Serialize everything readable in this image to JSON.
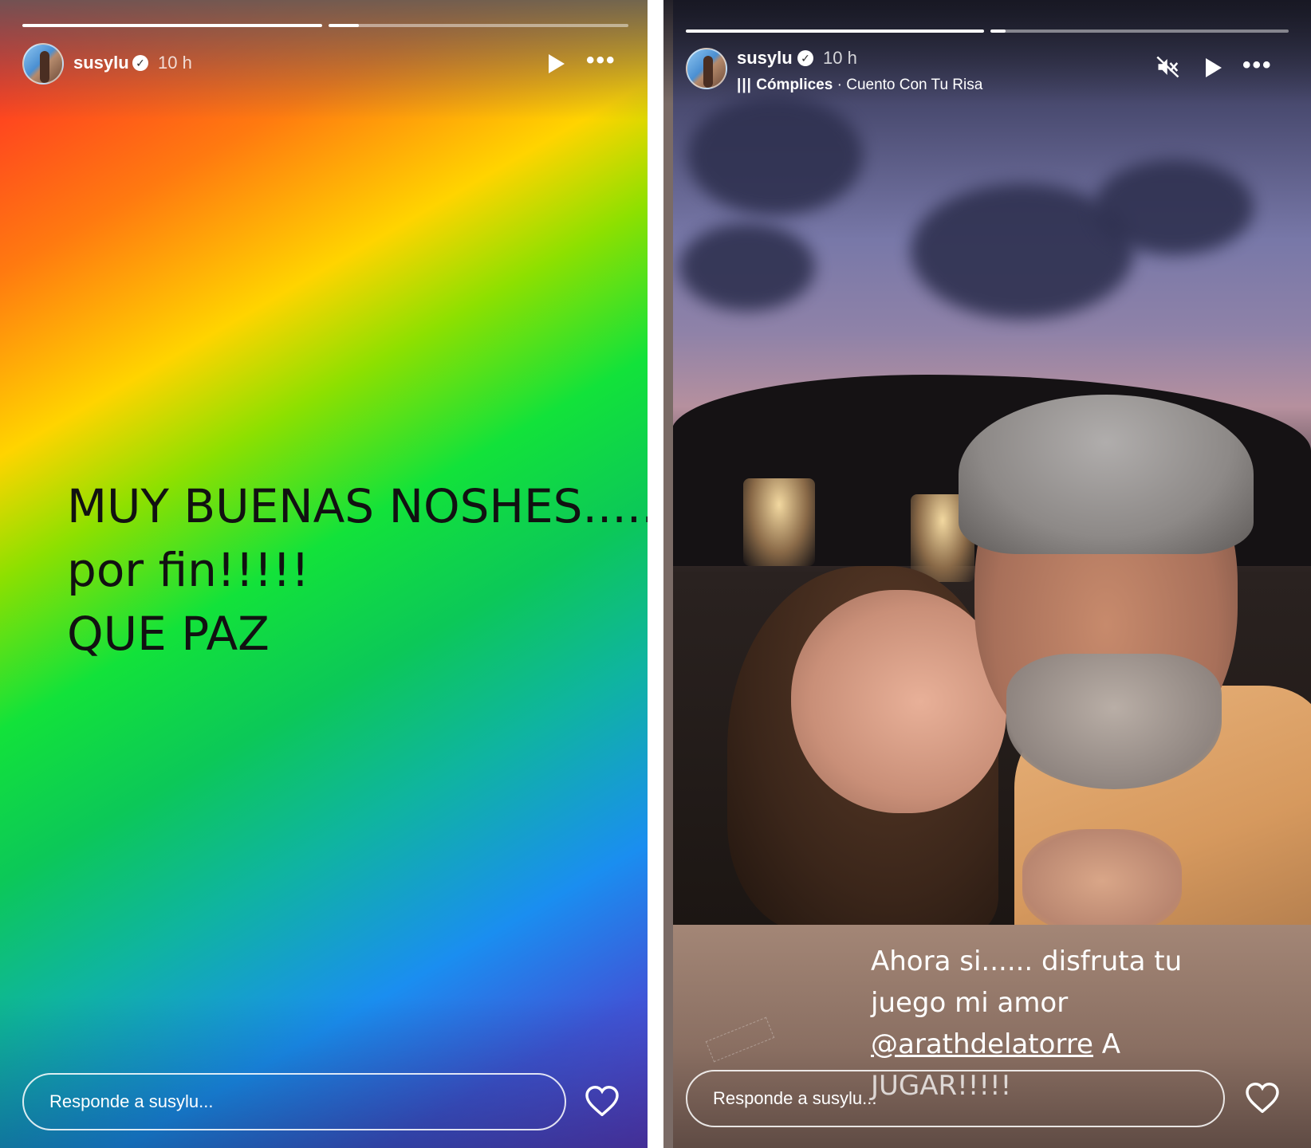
{
  "left_story": {
    "username": "susylu",
    "time": "10 h",
    "progress": [
      1,
      0.1
    ],
    "text_lines": [
      "MUY BUENAS NOSHES.....",
      "por fin!!!!!",
      "QUE PAZ"
    ],
    "reply_placeholder": "Responde a susylu..."
  },
  "right_story": {
    "username": "susylu",
    "time": "10 h",
    "progress": [
      1,
      0.05
    ],
    "music_title": "Cómplices",
    "music_separator": " · ",
    "music_song": "Cuento Con Tu Risa",
    "caption_line1": "Ahora si...... disfruta tu",
    "caption_line2": "juego mi amor",
    "caption_mention": "@arathdelatorre",
    "caption_after_mention": " A",
    "caption_line4": "JUGAR!!!!!",
    "reply_placeholder": "Responde a susylu..."
  },
  "icons": {
    "verified": "verified-badge-icon",
    "play": "play-icon",
    "more": "more-options-icon",
    "mute": "speaker-muted-icon",
    "heart": "heart-icon",
    "music": "music-bars-icon"
  },
  "colors": {
    "text_dark": "#111111",
    "text_light": "#ffffff"
  }
}
